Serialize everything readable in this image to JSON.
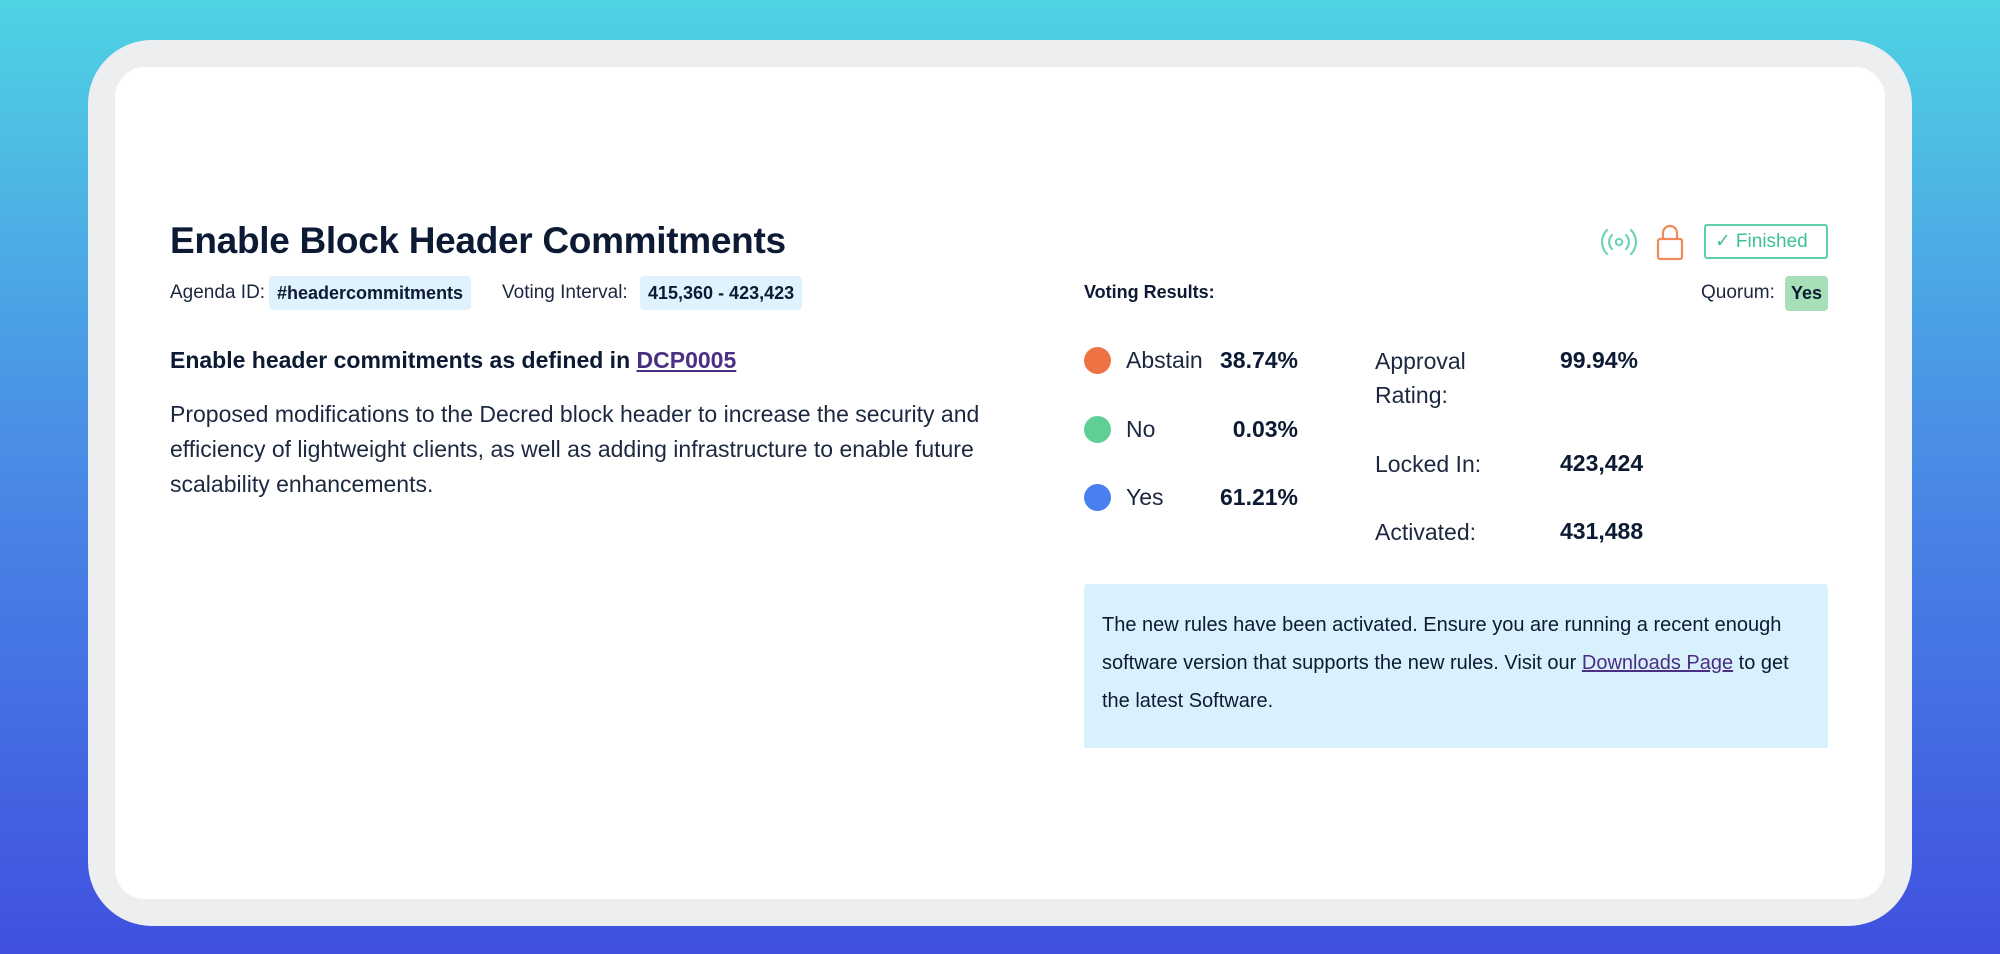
{
  "agenda": {
    "title": "Enable Block Header Commitments",
    "agenda_id_label": "Agenda ID:",
    "agenda_id": "#headercommitments",
    "voting_interval_label": "Voting Interval:",
    "voting_interval": "415,360 - 423,423",
    "subtitle_prefix": "Enable header commitments as defined in",
    "subtitle_link": "DCP0005",
    "description": "Proposed modifications to the Decred block header to increase the security and efficiency of lightweight clients, as well as adding infrastructure to enable future scalability enhancements."
  },
  "status": {
    "broadcast_icon": "broadcast-icon",
    "lock_icon": "lock-icon",
    "finished_label": "Finished",
    "colors": {
      "broadcast": "#6fd3b8",
      "lock": "#f08a5d",
      "finished": "#3ec195"
    }
  },
  "results": {
    "label": "Voting Results:",
    "quorum_label": "Quorum:",
    "quorum_value": "Yes",
    "votes": [
      {
        "name": "Abstain",
        "pct": "38.74%",
        "color": "#ee7344"
      },
      {
        "name": "No",
        "pct": "0.03%",
        "color": "#5fcf96"
      },
      {
        "name": "Yes",
        "pct": "61.21%",
        "color": "#4a7ff0"
      }
    ],
    "stats": [
      {
        "label": "Approval Rating:",
        "value": "99.94%"
      },
      {
        "label": "Locked In:",
        "value": "423,424"
      },
      {
        "label": "Activated:",
        "value": "431,488"
      }
    ]
  },
  "notice": {
    "text_before": "The new rules have been activated. Ensure you are running a recent enough software version that supports the new rules. Visit our",
    "link": "Downloads Page",
    "text_after": "to get the latest Software."
  }
}
